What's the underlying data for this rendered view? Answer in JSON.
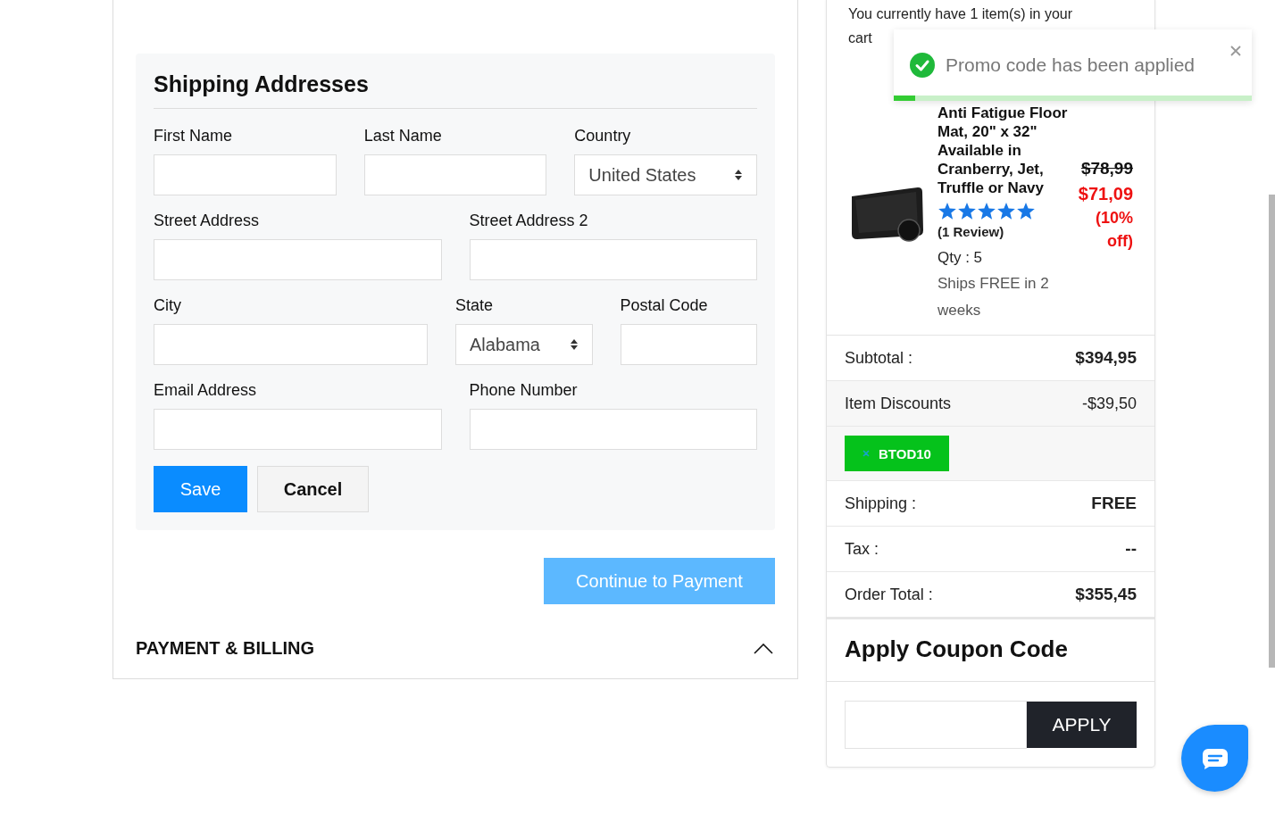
{
  "shipping_form": {
    "title": "Shipping Addresses",
    "rows": [
      {
        "fields": [
          {
            "label": "First Name",
            "kind": "text"
          },
          {
            "label": "Last Name",
            "kind": "text"
          },
          {
            "label": "Country",
            "kind": "select",
            "value": "United States"
          }
        ]
      },
      {
        "fields": [
          {
            "label": "Street Address",
            "kind": "text"
          },
          {
            "label": "Street Address 2",
            "kind": "text"
          }
        ]
      },
      {
        "fields": [
          {
            "label": "City",
            "kind": "text"
          },
          {
            "label": "State",
            "kind": "select",
            "value": "Alabama"
          },
          {
            "label": "Postal Code",
            "kind": "text"
          }
        ]
      },
      {
        "fields": [
          {
            "label": "Email Address",
            "kind": "text"
          },
          {
            "label": "Phone Number",
            "kind": "text"
          }
        ]
      }
    ],
    "save_button": "Save",
    "cancel_button": "Cancel"
  },
  "continue_button": {
    "label": "Continue to Payment",
    "disabled": true
  },
  "payment_section": {
    "title": "PAYMENT & BILLING"
  },
  "cart": {
    "message": "You currently have 1 item(s) in your cart",
    "item": {
      "title": "Anti Fatigue Floor Mat, 20\" x 32\" Available in Cranberry, Jet, Truffle or Navy",
      "stars": 5,
      "reviews": "(1 Review)",
      "qty": "Qty : 5",
      "shipping": "Ships FREE in 2 weeks",
      "original_price": "$78,99",
      "price": "$71,09",
      "discount": "(10% off)"
    },
    "summary": [
      {
        "kind": "amount",
        "label": "Subtotal :",
        "value": "$394,95"
      },
      {
        "kind": "discount",
        "label": "Item Discounts",
        "value": "-$39,50"
      },
      {
        "kind": "coupon",
        "code": "BTOD10"
      },
      {
        "kind": "amount",
        "label": "Shipping :",
        "value": "FREE"
      },
      {
        "kind": "amount",
        "label": "Tax :",
        "value": "--"
      },
      {
        "kind": "amount",
        "label": "Order Total :",
        "value": "$355,45"
      }
    ],
    "coupon_section": {
      "title": "Apply Coupon Code",
      "button": "APPLY"
    }
  },
  "toast": {
    "message": "Promo code has been applied",
    "level": 0.06
  }
}
